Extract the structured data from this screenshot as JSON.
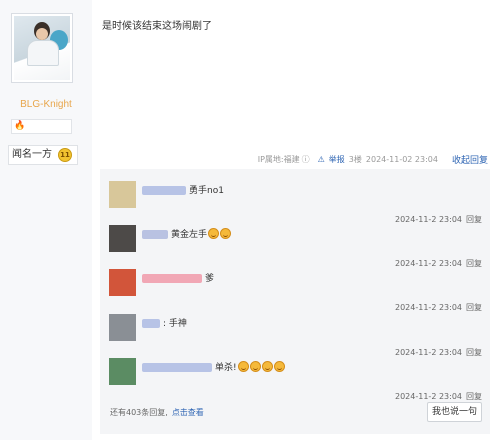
{
  "author": {
    "name": "BLG-Knight",
    "title": "闻名一方",
    "title_badge": "11",
    "colors": {
      "name": "#e8a64c"
    }
  },
  "post": {
    "text": "是时候该结束这场闹剧了",
    "ip_label": "IP属地:福建",
    "report": "举报",
    "floor": "3楼",
    "date": "2024-11-02 23:04",
    "collapse": "收起回复"
  },
  "replies": [
    {
      "text": "勇手no1",
      "time": "2024-11-2 23:04",
      "reply": "回复",
      "emoji_count": 0,
      "avatar_color": "#d8c79a",
      "name_color": "#b7c3e6"
    },
    {
      "text": "黄金左手",
      "time": "2024-11-2 23:04",
      "reply": "回复",
      "emoji_count": 2,
      "avatar_color": "#4d4a48",
      "name_color": "#b9c2e2"
    },
    {
      "text": "爹",
      "time": "2024-11-2 23:04",
      "reply": "回复",
      "emoji_count": 0,
      "avatar_color": "#d2553a",
      "name_color": "#f1a7b5"
    },
    {
      "text": ": 手神",
      "time": "2024-11-2 23:04",
      "reply": "回复",
      "emoji_count": 0,
      "avatar_color": "#8a8f95",
      "name_color": "#b7c3e6"
    },
    {
      "text": "单杀!",
      "time": "2024-11-2 23:04",
      "reply": "回复",
      "emoji_count": 4,
      "avatar_color": "#5b8c63",
      "name_color": "#b7c3e6"
    }
  ],
  "footer": {
    "more_text": "还有403条回复,",
    "more_link": "点击查看",
    "say_button": "我也说一句"
  },
  "icons": {
    "question": "question-icon",
    "warning": "warning-icon"
  }
}
